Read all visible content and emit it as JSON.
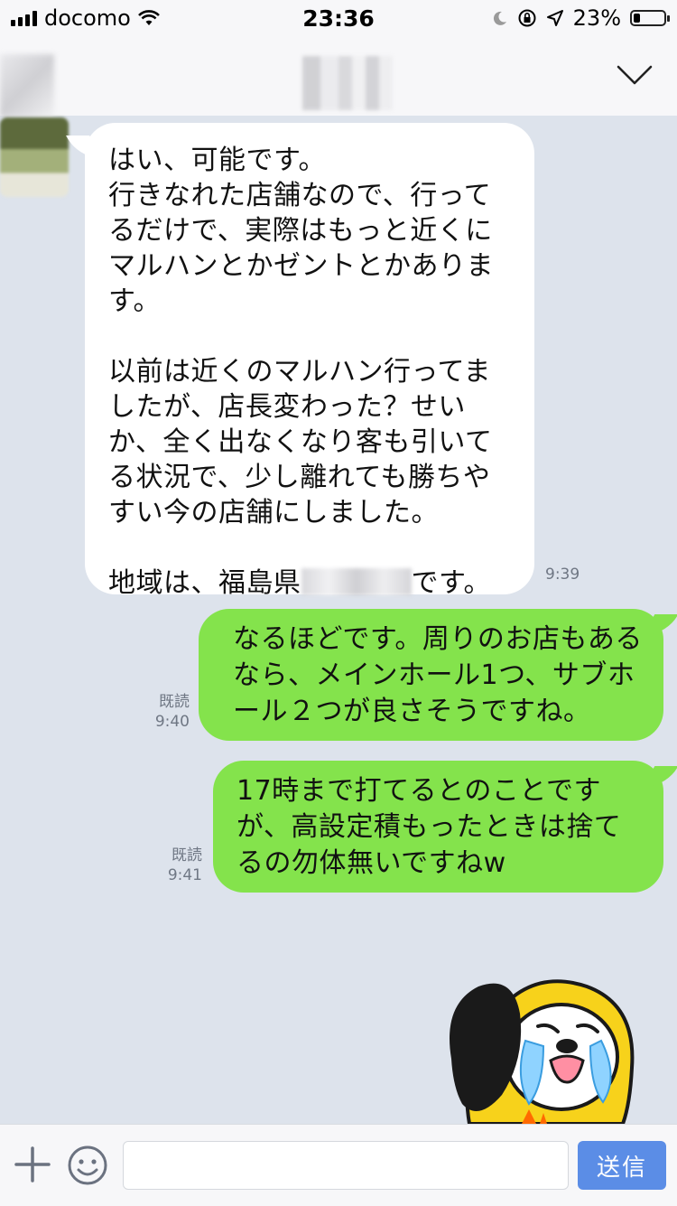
{
  "status_bar": {
    "carrier": "docomo",
    "time": "23:36",
    "battery_text": "23%",
    "battery_level": 0.23
  },
  "header": {
    "collapse_icon": "chevron-down-icon"
  },
  "messages": {
    "incoming": {
      "text_main": "はい、可能です。\n行きなれた店舗なので、行ってるだけで、実際はもっと近くにマルハンとかゼントとかあります。\n\n以前は近くのマルハン行ってましたが、店長変わった？せいか、全く出なくなり客も引いてる状況で、少し離れても勝ちやすい今の店舗にしました。\n\n",
      "text_region_prefix": "地域は、福島県",
      "text_region_suffix": "です。",
      "time": "9:39"
    },
    "outgoing": [
      {
        "text": "なるほどです。周りのお店もあるなら、メインホール1つ、サブホール２つが良さそうですね。",
        "read_label": "既読",
        "time": "9:40"
      },
      {
        "text": "17時まで打てるとのことですが、高設定積もったときは捨てるの勿体無いですねw",
        "read_label": "既読",
        "time": "9:41"
      }
    ],
    "sticker": "crying-dog-sticker"
  },
  "input_bar": {
    "plus_icon": "plus-icon",
    "emoji_icon": "smiley-icon",
    "placeholder": "",
    "send_label": "送信"
  },
  "colors": {
    "chat_background": "#dde3ec",
    "outgoing_bubble": "#84e34c",
    "incoming_bubble": "#ffffff",
    "send_button": "#5b8de6"
  }
}
